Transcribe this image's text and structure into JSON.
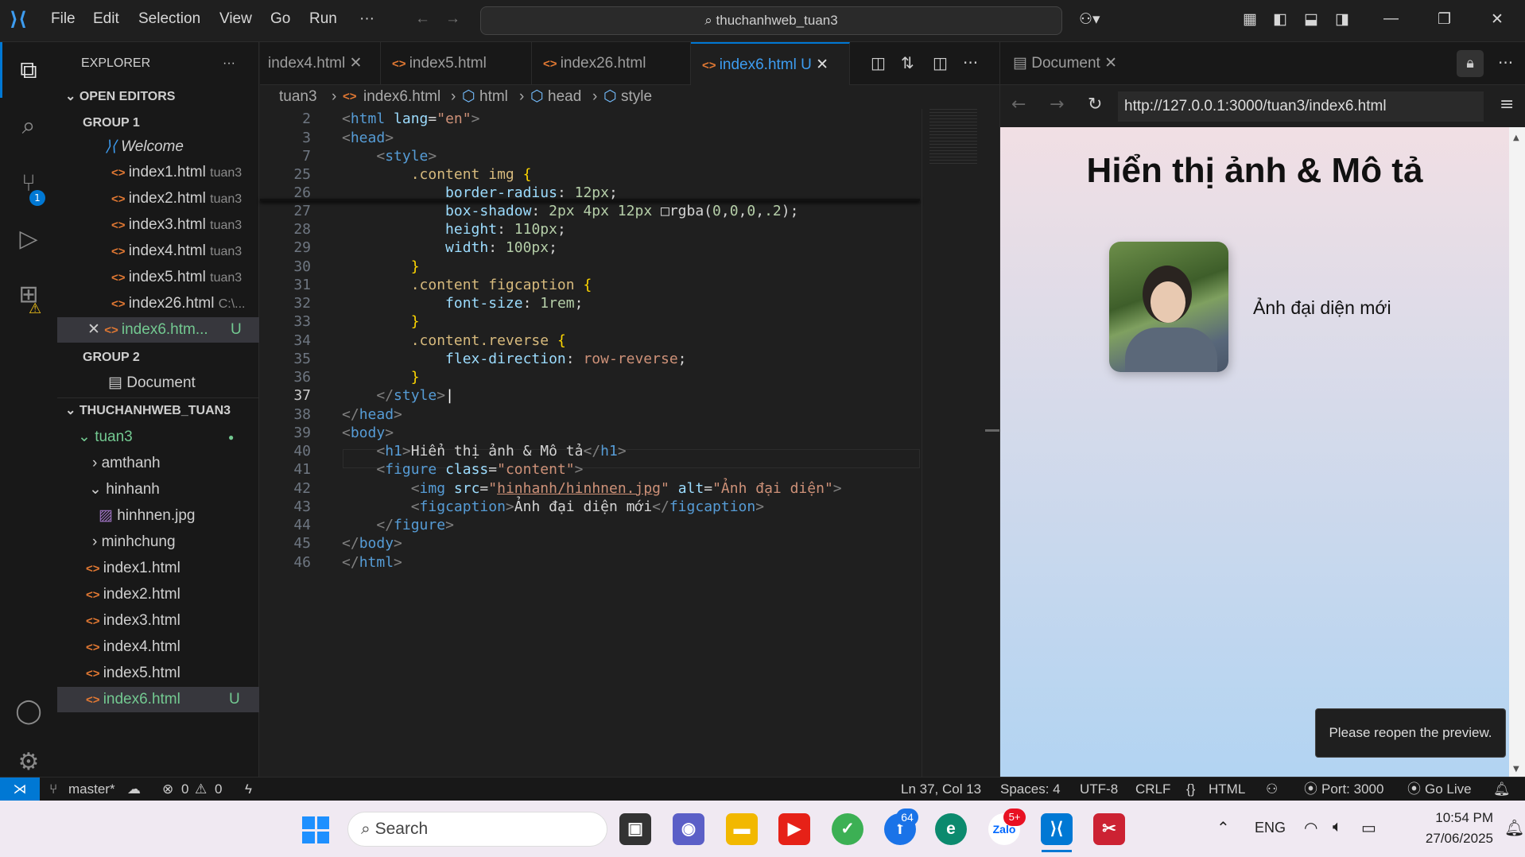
{
  "menu": {
    "file": "File",
    "edit": "Edit",
    "selection": "Selection",
    "view": "View",
    "go": "Go",
    "run": "Run"
  },
  "search_box": "thuchanhweb_tuan3",
  "explorer": {
    "title": "EXPLORER",
    "open_editors": "OPEN EDITORS",
    "group1": "GROUP 1",
    "group2": "GROUP 2",
    "welcome": "Welcome",
    "document": "Document",
    "files": [
      {
        "name": "index1.html",
        "path": "tuan3"
      },
      {
        "name": "index2.html",
        "path": "tuan3"
      },
      {
        "name": "index3.html",
        "path": "tuan3"
      },
      {
        "name": "index4.html",
        "path": "tuan3"
      },
      {
        "name": "index5.html",
        "path": "tuan3"
      },
      {
        "name": "index26.html",
        "path": "C:\\..."
      },
      {
        "name": "index6.htm...",
        "path": "U"
      }
    ],
    "workspace": "THUCHANHWEB_TUAN3",
    "folder": "tuan3",
    "amthanh": "amthanh",
    "hinhanh": "hinhanh",
    "hinhnen": "hinhnen.jpg",
    "minhchung": "minhchung",
    "tree": [
      "index1.html",
      "index2.html",
      "index3.html",
      "index4.html",
      "index5.html",
      "index6.html"
    ],
    "u_badge": "U"
  },
  "tabs": [
    "index4.html",
    "index5.html",
    "index26.html",
    "index6.html"
  ],
  "tab_u": "U",
  "breadcrumb": [
    "tuan3",
    "index6.html",
    "html",
    "head",
    "style"
  ],
  "code_lines": [
    "2",
    "3",
    "7",
    "25",
    "26",
    "27",
    "28",
    "29",
    "30",
    "31",
    "32",
    "33",
    "34",
    "35",
    "36",
    "37",
    "38",
    "39",
    "40",
    "41",
    "42",
    "43",
    "44",
    "45",
    "46"
  ],
  "preview": {
    "tab": "Document",
    "url": "http://127.0.0.1:3000/tuan3/index6.html",
    "heading": "Hiển thị ảnh & Mô tả",
    "caption": "Ảnh đại diện mới",
    "toast": "Please reopen the preview."
  },
  "status": {
    "branch": "master*",
    "errors": "0",
    "warnings": "0",
    "position": "Ln 37, Col 13",
    "spaces": "Spaces: 4",
    "encoding": "UTF-8",
    "eol": "CRLF",
    "language": "HTML",
    "port": "Port: 3000",
    "golive": "Go Live"
  },
  "taskbar": {
    "search": "Search",
    "lang": "ENG",
    "time": "10:54 PM",
    "date": "27/06/2025",
    "badge_a": "64",
    "badge_b": "5+"
  }
}
